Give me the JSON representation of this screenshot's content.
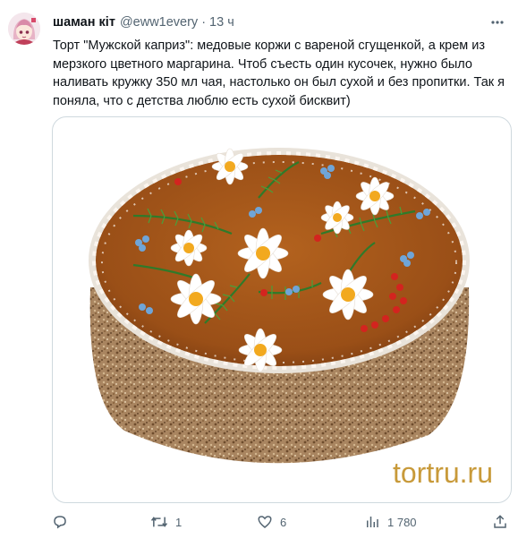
{
  "tweet": {
    "author_name": "шаман кіт",
    "handle": "@eww1every",
    "separator": "·",
    "time": "13 ч",
    "text": "Торт \"Мужской каприз\": медовые коржи с вареной сгущенкой, а крем из мерзкого цветного маргарина. Чтоб съесть один кусочек, нужно было наливать кружку 350 мл чая, настолько он был сухой и без пропитки. Так я поняла, что с детства люблю есть сухой бисквит)",
    "media": {
      "watermark": "tortru.ru"
    },
    "actions": {
      "reply_count": "",
      "retweet_count": "1",
      "like_count": "6",
      "view_count": "1 780"
    }
  },
  "icons": {
    "avatar": "anime-girl-avatar",
    "more": "more-icon",
    "reply": "reply-icon",
    "retweet": "retweet-icon",
    "like": "heart-icon",
    "views": "views-icon",
    "share": "share-icon"
  },
  "colors": {
    "text": "#0f1419",
    "muted": "#536471",
    "border": "#cfd9de",
    "watermark": "#c89a3a"
  }
}
